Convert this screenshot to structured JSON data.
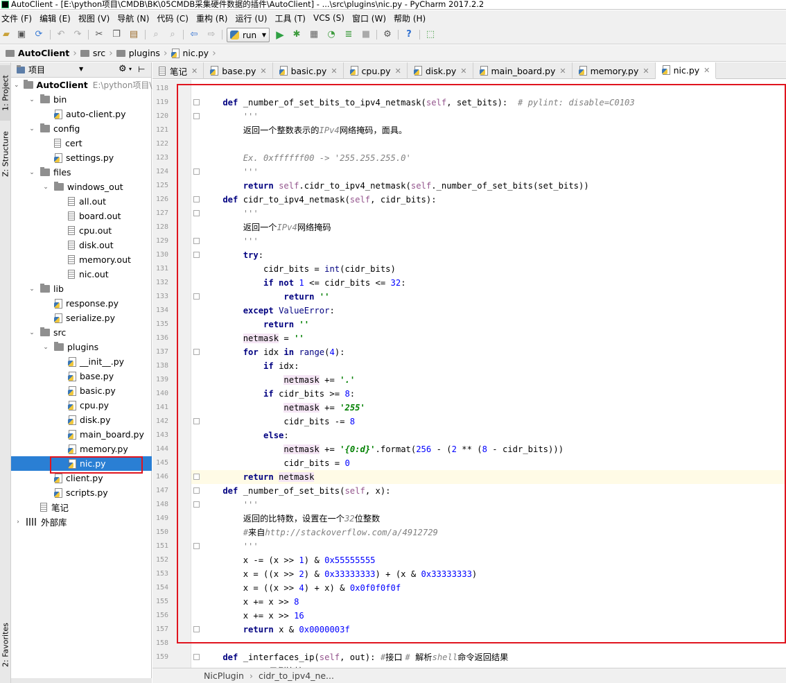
{
  "window": {
    "title": "AutoClient - [E:\\python项目\\CMDB\\BK\\05CMDB采集硬件数据的插件\\AutoClient] - ...\\src\\plugins\\nic.py - PyCharm 2017.2.2"
  },
  "menu": [
    "文件 (F)",
    "编辑 (E)",
    "视图 (V)",
    "导航 (N)",
    "代码 (C)",
    "重构 (R)",
    "运行 (U)",
    "工具 (T)",
    "VCS (S)",
    "窗口 (W)",
    "帮助 (H)"
  ],
  "toolbar": {
    "run_config": "run",
    "icons": [
      "open-folder-icon",
      "save-icon",
      "sync-icon",
      "undo-icon",
      "redo-icon",
      "cut-icon",
      "copy-icon",
      "paste-icon",
      "find-icon",
      "replace-icon",
      "back-icon",
      "forward-icon",
      "run-icon",
      "debug-icon",
      "coverage-icon",
      "profile-icon",
      "build-icon",
      "stop-icon",
      "settings-icon",
      "help-icon",
      "vcs-icon"
    ]
  },
  "breadcrumb": [
    "AutoClient",
    "src",
    "plugins",
    "nic.py"
  ],
  "left_tools": {
    "project": "1: Project",
    "structure": "Z: Structure",
    "favorites": "2: Favorites"
  },
  "project_panel": {
    "title": "项目"
  },
  "tree": [
    {
      "label": "AutoClient",
      "hint": "E:\\python项目\\C",
      "type": "folder",
      "depth": 0,
      "arrow": "down",
      "bold": true
    },
    {
      "label": "bin",
      "type": "folder",
      "depth": 1,
      "arrow": "down"
    },
    {
      "label": "auto-client.py",
      "type": "py",
      "depth": 2
    },
    {
      "label": "config",
      "type": "folder",
      "depth": 1,
      "arrow": "down"
    },
    {
      "label": "cert",
      "type": "file",
      "depth": 2
    },
    {
      "label": "settings.py",
      "type": "py",
      "depth": 2
    },
    {
      "label": "files",
      "type": "folder",
      "depth": 1,
      "arrow": "down"
    },
    {
      "label": "windows_out",
      "type": "folder",
      "depth": 2,
      "arrow": "down"
    },
    {
      "label": "all.out",
      "type": "file",
      "depth": 3
    },
    {
      "label": "board.out",
      "type": "file",
      "depth": 3
    },
    {
      "label": "cpu.out",
      "type": "file",
      "depth": 3
    },
    {
      "label": "disk.out",
      "type": "file",
      "depth": 3
    },
    {
      "label": "memory.out",
      "type": "file",
      "depth": 3
    },
    {
      "label": "nic.out",
      "type": "file",
      "depth": 3
    },
    {
      "label": "lib",
      "type": "folder",
      "depth": 1,
      "arrow": "down"
    },
    {
      "label": "response.py",
      "type": "py",
      "depth": 2
    },
    {
      "label": "serialize.py",
      "type": "py",
      "depth": 2
    },
    {
      "label": "src",
      "type": "folder",
      "depth": 1,
      "arrow": "down"
    },
    {
      "label": "plugins",
      "type": "folder",
      "depth": 2,
      "arrow": "down"
    },
    {
      "label": "__init__.py",
      "type": "py",
      "depth": 3
    },
    {
      "label": "base.py",
      "type": "py",
      "depth": 3
    },
    {
      "label": "basic.py",
      "type": "py",
      "depth": 3
    },
    {
      "label": "cpu.py",
      "type": "py",
      "depth": 3
    },
    {
      "label": "disk.py",
      "type": "py",
      "depth": 3
    },
    {
      "label": "main_board.py",
      "type": "py",
      "depth": 3
    },
    {
      "label": "memory.py",
      "type": "py",
      "depth": 3
    },
    {
      "label": "nic.py",
      "type": "py",
      "depth": 3,
      "selected": true
    },
    {
      "label": "client.py",
      "type": "py",
      "depth": 2
    },
    {
      "label": "scripts.py",
      "type": "py",
      "depth": 2
    },
    {
      "label": "笔记",
      "type": "file",
      "depth": 1
    },
    {
      "label": "外部库",
      "type": "lib",
      "depth": 0,
      "arrow": "right"
    }
  ],
  "tabs": [
    {
      "label": "笔记",
      "icon": "file"
    },
    {
      "label": "base.py",
      "icon": "py"
    },
    {
      "label": "basic.py",
      "icon": "py"
    },
    {
      "label": "cpu.py",
      "icon": "py"
    },
    {
      "label": "disk.py",
      "icon": "py"
    },
    {
      "label": "main_board.py",
      "icon": "py"
    },
    {
      "label": "memory.py",
      "icon": "py"
    },
    {
      "label": "nic.py",
      "icon": "py",
      "active": true
    }
  ],
  "code": [
    {
      "n": "118",
      "t": []
    },
    {
      "n": "119",
      "t": [
        [
          "k",
          "    def "
        ],
        [
          "fn",
          "_number_of_set_bits_to_ipv4_netmask("
        ],
        [
          "sf",
          "self"
        ],
        [
          "fn",
          ", set_bits):  "
        ],
        [
          "c",
          "# pylint: disable=C0103"
        ]
      ]
    },
    {
      "n": "120",
      "t": [
        [
          "doc",
          "        '''"
        ]
      ]
    },
    {
      "n": "121",
      "t": [
        [
          "doc",
          "        "
        ],
        [
          "cn",
          "返回一个整数表示的"
        ],
        [
          "doc",
          "IPv4"
        ],
        [
          "cn",
          "网络掩码，面具。"
        ]
      ]
    },
    {
      "n": "122",
      "t": []
    },
    {
      "n": "123",
      "t": [
        [
          "doc",
          "        Ex. 0xffffff00 -> '255.255.255.0'"
        ]
      ]
    },
    {
      "n": "124",
      "t": [
        [
          "doc",
          "        '''"
        ]
      ]
    },
    {
      "n": "125",
      "t": [
        [
          "k",
          "        return "
        ],
        [
          "sf",
          "self"
        ],
        [
          "fn",
          ".cidr_to_ipv4_netmask("
        ],
        [
          "sf",
          "self"
        ],
        [
          "fn",
          "._number_of_set_bits(set_bits))"
        ]
      ]
    },
    {
      "n": "126",
      "t": [
        [
          "k",
          "    def "
        ],
        [
          "fn",
          "cidr_to_ipv4_netmask("
        ],
        [
          "sf",
          "self"
        ],
        [
          "fn",
          ", cidr_bits):"
        ]
      ]
    },
    {
      "n": "127",
      "t": [
        [
          "doc",
          "        '''"
        ]
      ]
    },
    {
      "n": "128",
      "t": [
        [
          "doc",
          "        "
        ],
        [
          "cn",
          "返回一个"
        ],
        [
          "doc",
          "IPv4"
        ],
        [
          "cn",
          "网络掩码"
        ]
      ]
    },
    {
      "n": "129",
      "t": [
        [
          "doc",
          "        '''"
        ]
      ]
    },
    {
      "n": "130",
      "t": [
        [
          "k",
          "        try"
        ],
        [
          "fn",
          ":"
        ]
      ]
    },
    {
      "n": "131",
      "t": [
        [
          "fn",
          "            cidr_bits = "
        ],
        [
          "b",
          "int"
        ],
        [
          "fn",
          "(cidr_bits)"
        ]
      ]
    },
    {
      "n": "132",
      "t": [
        [
          "k",
          "            if not "
        ],
        [
          "n",
          "1"
        ],
        [
          "fn",
          " <= cidr_bits <= "
        ],
        [
          "n",
          "32"
        ],
        [
          "fn",
          ":"
        ]
      ]
    },
    {
      "n": "133",
      "t": [
        [
          "k",
          "                return "
        ],
        [
          "s",
          "''"
        ]
      ]
    },
    {
      "n": "134",
      "t": [
        [
          "k",
          "        except "
        ],
        [
          "b",
          "ValueError"
        ],
        [
          "fn",
          ":"
        ]
      ]
    },
    {
      "n": "135",
      "t": [
        [
          "k",
          "            return "
        ],
        [
          "s",
          "''"
        ]
      ]
    },
    {
      "n": "136",
      "t": [
        [
          "fn",
          "        "
        ],
        [
          "hl",
          "netmask"
        ],
        [
          "fn",
          " = "
        ],
        [
          "s",
          "''"
        ]
      ]
    },
    {
      "n": "137",
      "t": [
        [
          "k",
          "        for "
        ],
        [
          "fn",
          "idx "
        ],
        [
          "k",
          "in "
        ],
        [
          "b",
          "range"
        ],
        [
          "fn",
          "("
        ],
        [
          "n",
          "4"
        ],
        [
          "fn",
          "):"
        ]
      ]
    },
    {
      "n": "138",
      "t": [
        [
          "k",
          "            if "
        ],
        [
          "fn",
          "idx:"
        ]
      ]
    },
    {
      "n": "139",
      "t": [
        [
          "fn",
          "                "
        ],
        [
          "hl",
          "netmask"
        ],
        [
          "fn",
          " += "
        ],
        [
          "s",
          "'.'"
        ]
      ]
    },
    {
      "n": "140",
      "t": [
        [
          "k",
          "            if "
        ],
        [
          "fn",
          "cidr_bits >= "
        ],
        [
          "n",
          "8"
        ],
        [
          "fn",
          ":"
        ]
      ]
    },
    {
      "n": "141",
      "t": [
        [
          "fn",
          "                "
        ],
        [
          "hl",
          "netmask"
        ],
        [
          "fn",
          " += "
        ],
        [
          "s",
          "'255'"
        ]
      ]
    },
    {
      "n": "142",
      "t": [
        [
          "fn",
          "                cidr_bits -= "
        ],
        [
          "n",
          "8"
        ]
      ]
    },
    {
      "n": "143",
      "t": [
        [
          "k",
          "            else"
        ],
        [
          "fn",
          ":"
        ]
      ]
    },
    {
      "n": "144",
      "t": [
        [
          "fn",
          "                "
        ],
        [
          "hl",
          "netmask"
        ],
        [
          "fn",
          " += "
        ],
        [
          "s",
          "'{0:d}'"
        ],
        [
          "fn",
          ".format("
        ],
        [
          "n",
          "256"
        ],
        [
          "fn",
          " - ("
        ],
        [
          "n",
          "2"
        ],
        [
          "fn",
          " ** ("
        ],
        [
          "n",
          "8"
        ],
        [
          "fn",
          " - cidr_bits)))"
        ]
      ]
    },
    {
      "n": "145",
      "t": [
        [
          "fn",
          "                cidr_bits = "
        ],
        [
          "n",
          "0"
        ]
      ]
    },
    {
      "n": "146",
      "t": [
        [
          "k",
          "        return "
        ],
        [
          "hl",
          "netmask"
        ]
      ],
      "current": true
    },
    {
      "n": "147",
      "t": [
        [
          "k",
          "    def "
        ],
        [
          "fn",
          "_number_of_set_bits("
        ],
        [
          "sf",
          "self"
        ],
        [
          "fn",
          ", x):"
        ]
      ]
    },
    {
      "n": "148",
      "t": [
        [
          "doc",
          "        '''"
        ]
      ]
    },
    {
      "n": "149",
      "t": [
        [
          "doc",
          "        "
        ],
        [
          "cn",
          "返回的比特数，设置在一个"
        ],
        [
          "doc",
          "32"
        ],
        [
          "cn",
          "位整数"
        ]
      ]
    },
    {
      "n": "150",
      "t": [
        [
          "doc",
          "        #"
        ],
        [
          "cn",
          "来自"
        ],
        [
          "doc",
          "http://stackoverflow.com/a/4912729"
        ]
      ]
    },
    {
      "n": "151",
      "t": [
        [
          "doc",
          "        '''"
        ]
      ]
    },
    {
      "n": "152",
      "t": [
        [
          "fn",
          "        x -= (x >> "
        ],
        [
          "n",
          "1"
        ],
        [
          "fn",
          ") & "
        ],
        [
          "n",
          "0x55555555"
        ]
      ]
    },
    {
      "n": "153",
      "t": [
        [
          "fn",
          "        x = ((x >> "
        ],
        [
          "n",
          "2"
        ],
        [
          "fn",
          ") & "
        ],
        [
          "n",
          "0x33333333"
        ],
        [
          "fn",
          ") + (x & "
        ],
        [
          "n",
          "0x33333333"
        ],
        [
          "fn",
          ")"
        ]
      ]
    },
    {
      "n": "154",
      "t": [
        [
          "fn",
          "        x = ((x >> "
        ],
        [
          "n",
          "4"
        ],
        [
          "fn",
          ") + x) & "
        ],
        [
          "n",
          "0x0f0f0f0f"
        ]
      ]
    },
    {
      "n": "155",
      "t": [
        [
          "fn",
          "        x += x >> "
        ],
        [
          "n",
          "8"
        ]
      ]
    },
    {
      "n": "156",
      "t": [
        [
          "fn",
          "        x += x >> "
        ],
        [
          "n",
          "16"
        ]
      ]
    },
    {
      "n": "157",
      "t": [
        [
          "k",
          "        return "
        ],
        [
          "fn",
          "x & "
        ],
        [
          "n",
          "0x0000003f"
        ]
      ]
    },
    {
      "n": "158",
      "t": []
    },
    {
      "n": "159",
      "t": [
        [
          "k",
          "    def "
        ],
        [
          "fn",
          "_interfaces_ip("
        ],
        [
          "sf",
          "self"
        ],
        [
          "fn",
          ", out): "
        ],
        [
          "c",
          "#"
        ],
        [
          "cn",
          "接口 "
        ],
        [
          "c",
          "# "
        ],
        [
          "cn",
          "解析"
        ],
        [
          "c",
          "shell"
        ],
        [
          "cn",
          "命令返回结果"
        ]
      ]
    },
    {
      "n": "",
      "t": [
        [
          "doc",
          "        '''"
        ],
        [
          "cn",
          "    示例比较"
        ]
      ]
    }
  ],
  "status": {
    "crumbs": [
      "NicPlugin",
      "cidr_to_ipv4_ne..."
    ]
  }
}
